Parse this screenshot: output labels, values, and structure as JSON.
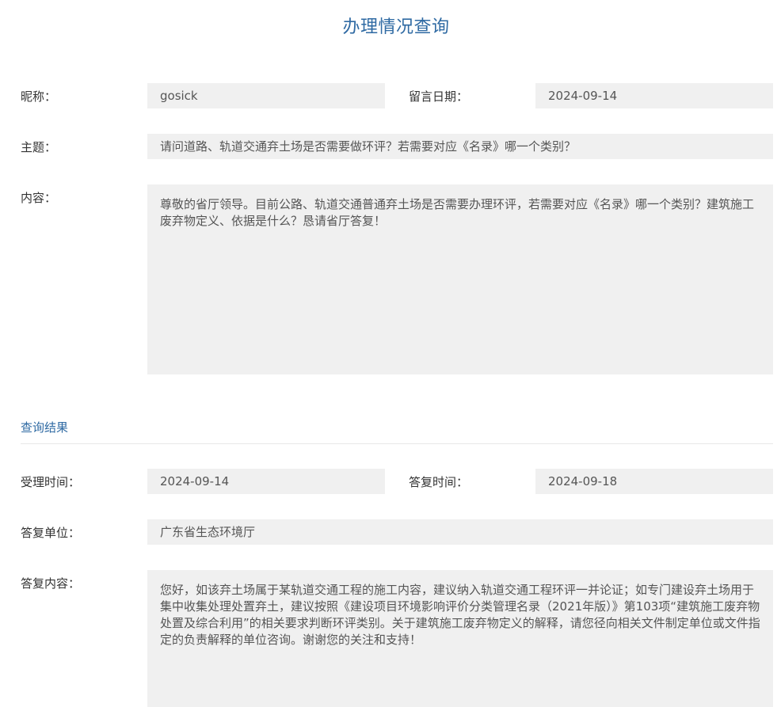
{
  "page": {
    "title": "办理情况查询"
  },
  "message": {
    "nickname_label": "昵称：",
    "nickname": "gosick",
    "date_label": "留言日期：",
    "date": "2024-09-14",
    "subject_label": "主题：",
    "subject": "请问道路、轨道交通弃土场是否需要做环评？若需要对应《名录》哪一个类别？",
    "content_label": "内容：",
    "content": "尊敬的省厅领导。目前公路、轨道交通普通弃土场是否需要办理环评，若需要对应《名录》哪一个类别？建筑施工废弃物定义、依据是什么？恳请省厅答复！"
  },
  "result": {
    "section_title": "查询结果",
    "accept_time_label": "受理时间：",
    "accept_time": "2024-09-14",
    "reply_time_label": "答复时间：",
    "reply_time": "2024-09-18",
    "reply_unit_label": "答复单位：",
    "reply_unit": "广东省生态环境厅",
    "reply_content_label": "答复内容：",
    "reply_content": "您好，如该弃土场属于某轨道交通工程的施工内容，建议纳入轨道交通工程环评一并论证；如专门建设弃土场用于集中收集处理处置弃土，建议按照《建设项目环境影响评价分类管理名录（2021年版）》第103项“建筑施工废弃物处置及综合利用”的相关要求判断环评类别。关于建筑施工废弃物定义的解释，请您径向相关文件制定单位或文件指定的负责解释的单位咨询。谢谢您的关注和支持！"
  },
  "colors": {
    "accent": "#2f6aa3",
    "field_bg": "#f0f0f0",
    "label_text": "#333333",
    "value_text": "#555555"
  }
}
